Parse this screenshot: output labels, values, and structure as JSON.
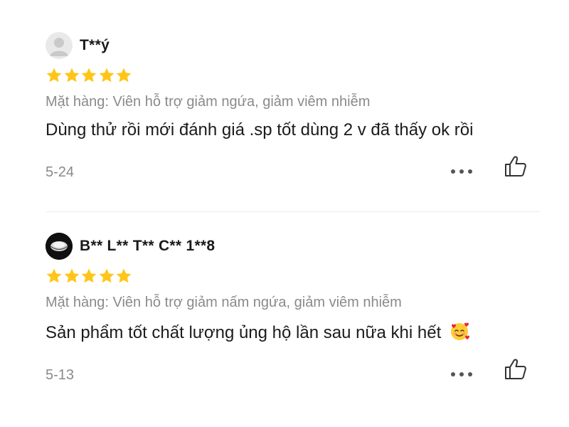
{
  "reviews": [
    {
      "username": "T**ý",
      "rating": 5,
      "item": "Mặt hàng: Viên hỗ trợ giảm ngứa, giảm viêm nhiễm",
      "text": "Dùng thử rồi mới đánh giá .sp tốt dùng 2 v đã thấy ok rồi",
      "date": "5-24",
      "avatar_icon": "default-user-avatar-icon"
    },
    {
      "username": "B** L** T** C** 1**8",
      "rating": 5,
      "item": "Mặt hàng: Viên hỗ trợ giảm nấm ngứa, giảm viêm nhiễm",
      "text": "Sản phẩm tốt chất lượng ủng hộ lần sau nữa khi hết",
      "text_emoji": "smiling-face-with-hearts-icon",
      "date": "5-13",
      "avatar_icon": "dark-photo-avatar-icon"
    }
  ],
  "colors": {
    "star": "#FFC61A",
    "muted": "#8a8a8a",
    "text": "#1b1b1b"
  }
}
